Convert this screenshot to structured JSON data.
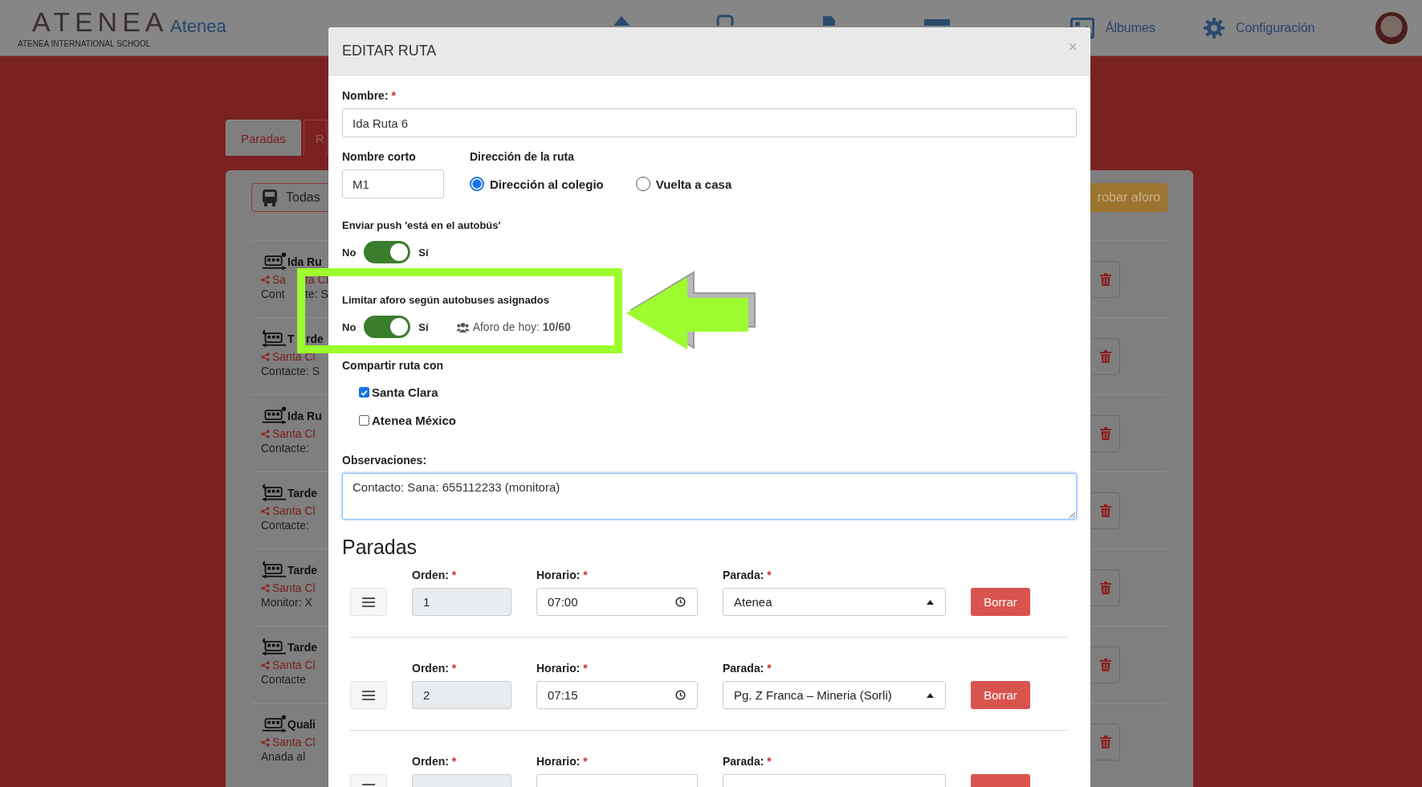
{
  "header": {
    "logo": "ATENEA",
    "logo_subtitle": "ATENEA INTERNATIONAL SCHOOL",
    "brand": "Atenea",
    "nav": [
      {
        "kind": "albums",
        "label": "Álbumes"
      },
      {
        "kind": "settings",
        "label": "Configuración"
      }
    ]
  },
  "background": {
    "tabs": [
      {
        "label": "Paradas",
        "selected": false
      },
      {
        "label": "R",
        "selected": true
      }
    ],
    "filter_button": "Todas",
    "check_button": "robar aforo",
    "routes": [
      {
        "kind": "ida",
        "title": [
          "Ida Ru"
        ],
        "shared": [
          "Sa",
          "ta Cl"
        ],
        "note": [
          "Cont",
          "te: S"
        ]
      },
      {
        "kind": "vuelta",
        "title": [
          "T",
          "rde"
        ],
        "shared": [
          "Santa Cl"
        ],
        "note": [
          "Contacte: S"
        ]
      },
      {
        "kind": "ida",
        "title": [
          "Ida Ru"
        ],
        "shared": [
          "Santa Cl"
        ],
        "note": [
          "Contacte:"
        ]
      },
      {
        "kind": "vuelta",
        "title": [
          "Tarde"
        ],
        "shared": [
          "Santa Cl"
        ],
        "note": [
          "Contacte:"
        ]
      },
      {
        "kind": "vuelta",
        "title": [
          "Tarde"
        ],
        "shared": [
          "Santa Cl"
        ],
        "note": [
          "Monitor: X"
        ]
      },
      {
        "kind": "vuelta",
        "title": [
          "Tarde"
        ],
        "shared": [
          "Santa Cl"
        ],
        "note": [
          "Contacte"
        ]
      },
      {
        "kind": "ida",
        "title": [
          "Quali"
        ],
        "shared": [
          "Santa Cl"
        ],
        "note": [
          "Anada al"
        ]
      }
    ]
  },
  "modal": {
    "title": "EDITAR RUTA",
    "close": "×",
    "name": {
      "label": "Nombre:",
      "mark": "*",
      "value": "Ida Ruta 6"
    },
    "short_name": {
      "label": "Nombre corto",
      "value": "M1"
    },
    "direction": {
      "label": "Dirección de la ruta",
      "options": [
        {
          "label": "Dirección al colegio",
          "selected": true
        },
        {
          "label": "Vuelta a casa",
          "selected": false
        }
      ]
    },
    "push": {
      "label": "Enviar push 'está en el autobús'",
      "off_label": "No",
      "on_label": "Sí",
      "on": true
    },
    "capacity": {
      "label": "Limitar aforo según autobuses asignados",
      "off_label": "No",
      "on_label": "Sí",
      "on": true,
      "info": "Aforo de hoy: **10/60**"
    },
    "share": {
      "label": "Compartir ruta con",
      "options": [
        {
          "label": "Santa Clara",
          "checked": true
        },
        {
          "label": "Atenea México",
          "checked": false
        }
      ]
    },
    "notes": {
      "label": "Observaciones:",
      "value": "Contacto: Sana: 655112233 (monitora)"
    },
    "stops_heading": "Paradas",
    "stops": [
      {
        "order_label": "Orden:",
        "order_mark": "*",
        "order": "1",
        "time_label": "Horario:",
        "time_mark": "*",
        "time": "07:00",
        "stop_label": "Parada:",
        "stop_mark": "*",
        "stop": "Atenea",
        "delete": "Borrar"
      },
      {
        "order_label": "Orden:",
        "order_mark": "*",
        "order": "2",
        "time_label": "Horario:",
        "time_mark": "*",
        "time": "07:15",
        "stop_label": "Parada:",
        "stop_mark": "*",
        "stop": "Pg. Z Franca – Mineria (Sorli)",
        "delete": "Borrar"
      },
      {
        "order_label": "Orden:",
        "order_mark": "*",
        "time_label": "Horario:",
        "time_mark": "*",
        "stop_label": "Parada:",
        "stop_mark": "*"
      }
    ]
  }
}
